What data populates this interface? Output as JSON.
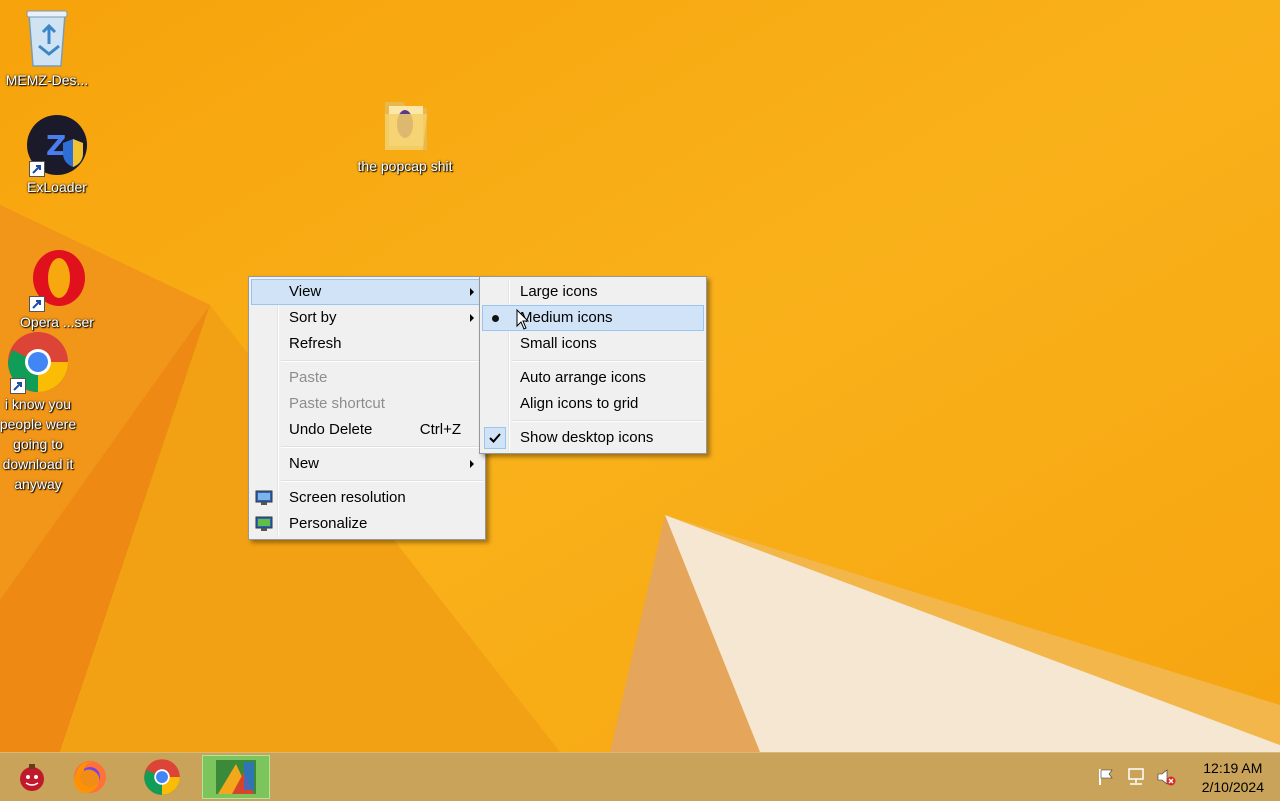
{
  "desktop_icons": [
    {
      "label": "MEMZ-Des...",
      "icon": "recycle-bin-icon"
    },
    {
      "label": "ExLoader",
      "icon": "exloader-icon"
    },
    {
      "label": "the popcap shit",
      "icon": "folder-icon"
    },
    {
      "label": "Opera\nBrowser",
      "icon": "opera-icon",
      "label_visible": "Opera ...ser"
    },
    {
      "label": "i know you people were going to download it anyway",
      "icon": "chrome-icon"
    }
  ],
  "context_menu": {
    "items": [
      {
        "label": "View",
        "submenu": true
      },
      {
        "label": "Sort by",
        "submenu": true
      },
      {
        "label": "Refresh"
      },
      {
        "label": "Paste",
        "disabled": true
      },
      {
        "label": "Paste shortcut",
        "disabled": true
      },
      {
        "label": "Undo Delete",
        "shortcut": "Ctrl+Z"
      },
      {
        "label": "New",
        "submenu": true
      },
      {
        "label": "Screen resolution",
        "icon": "display-icon"
      },
      {
        "label": "Personalize",
        "icon": "personalize-icon"
      }
    ]
  },
  "view_submenu": {
    "items": [
      {
        "label": "Large icons"
      },
      {
        "label": "Medium icons",
        "selected": true
      },
      {
        "label": "Small icons"
      },
      {
        "label": "Auto arrange icons"
      },
      {
        "label": "Align icons to grid"
      },
      {
        "label": "Show desktop icons",
        "checked": true
      }
    ]
  },
  "taskbar": {
    "apps": [
      "memz-icon",
      "firefox-icon",
      "chrome-icon",
      "image-viewer-icon"
    ],
    "tray": [
      "action-center-flag-icon",
      "network-icon",
      "volume-muted-icon"
    ],
    "time": "12:19 AM",
    "date": "2/10/2024"
  },
  "colors": {
    "wallpaper": "#f7a80f",
    "menu_bg": "#f0f0f0",
    "highlight": "#d1e3f6"
  }
}
